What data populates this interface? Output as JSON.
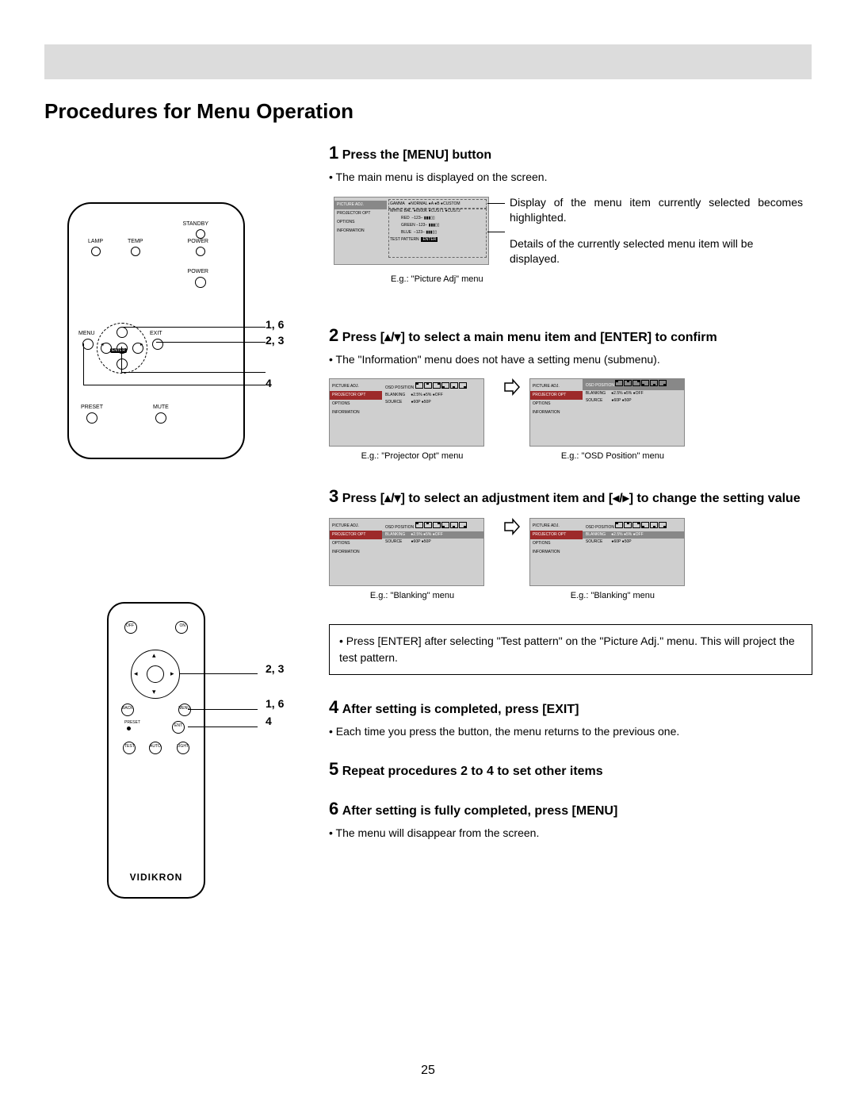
{
  "page": {
    "title": "Procedures for Menu Operation",
    "number": "25"
  },
  "topunit": {
    "labels": {
      "standby": "STANDBY",
      "lamp": "LAMP",
      "temp": "TEMP",
      "powerLed": "POWER",
      "powerBtn": "POWER",
      "menu": "MENU",
      "exit": "EXIT",
      "enter": "ENTER",
      "preset": "PRESET",
      "mute": "MUTE"
    },
    "annots": {
      "a": "1, 6",
      "b": "2, 3",
      "c": "4"
    }
  },
  "remote": {
    "labels": {
      "off": "OFF",
      "on": "ON",
      "back": "BACK",
      "menu": "MENU",
      "preset": "PRESET",
      "ent": "ENT",
      "test": "TEST",
      "auto": "AUTO",
      "light": "LIGHT",
      "logo": "VIDIKRON"
    },
    "annots": {
      "a": "2, 3",
      "b": "1, 6",
      "c": "4"
    }
  },
  "steps": {
    "s1": {
      "num": "1",
      "head": "Press the [MENU] button",
      "bul": "The main menu is displayed on the screen.",
      "lead1": "Display of the menu item currently selected becomes highlighted.",
      "lead2": "Details of the currently selected menu item will be displayed.",
      "cap": "E.g.: \"Picture Adj\" menu"
    },
    "s2": {
      "num": "2",
      "head": "Press [▴/▾] to select a main menu item and [ENTER] to confirm",
      "bul": "The \"Information\" menu does not have a setting menu (submenu).",
      "capL": "E.g.: \"Projector Opt\" menu",
      "capR": "E.g.: \"OSD Position\" menu"
    },
    "s3": {
      "num": "3",
      "head": "Press [▴/▾] to select an adjustment item and [◂/▸] to change the setting value",
      "capL": "E.g.: \"Blanking\" menu",
      "capR": "E.g.: \"Blanking\" menu"
    },
    "note": "Press [ENTER] after selecting \"Test pattern\" on the \"Picture Adj.\" menu. This will project the test pattern.",
    "s4": {
      "num": "4",
      "head": "After setting is completed, press [EXIT]",
      "bul": "Each time you press the button, the menu returns to the previous one."
    },
    "s5": {
      "num": "5",
      "head": "Repeat procedures 2 to 4 to set other items"
    },
    "s6": {
      "num": "6",
      "head": "After setting is fully completed, press [MENU]",
      "bul": "The menu will disappear from the screen."
    }
  },
  "osd": {
    "side": {
      "pic": "PICTURE ADJ.",
      "proj": "PROJECTOR OPT",
      "opt": "OPTIONS",
      "info": "INFORMATION"
    },
    "s1body": {
      "gamma": "GAMMA",
      "gNormal": "NORMAL",
      "gA": "A",
      "gB": "B",
      "gCustom": "CUSTOM",
      "wb": "WHITE BAL.",
      "w6500": "6500K",
      "wC1": "CUST1",
      "wC2": "CUST2",
      "red": "RED",
      "green": "GREEN",
      "blue": "BLUE",
      "val": "−123−",
      "test": "TEST PATTERN",
      "enter": "ENTER"
    },
    "s2body": {
      "osdpos": "OSD POSITION",
      "blank": "BLANKING",
      "b25": "2.5%",
      "b5": "5%",
      "boff": "OFF",
      "src": "SOURCE",
      "s60": "60P",
      "s50": "50P"
    }
  }
}
